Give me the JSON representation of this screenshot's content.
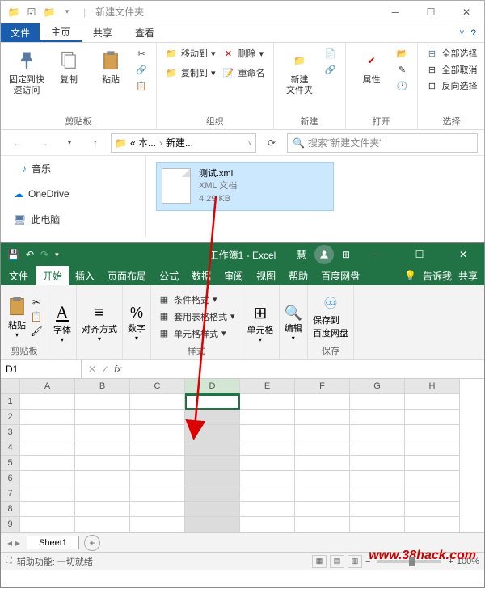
{
  "explorer": {
    "title": "新建文件夹",
    "tabs": {
      "file": "文件",
      "home": "主页",
      "share": "共享",
      "view": "查看"
    },
    "ribbon": {
      "clipboard": {
        "pin": "固定到快\n速访问",
        "copy": "复制",
        "paste": "粘贴",
        "label": "剪贴板"
      },
      "organize": {
        "moveto": "移动到",
        "delete": "删除",
        "copyto": "复制到",
        "rename": "重命名",
        "label": "组织"
      },
      "new": {
        "folder": "新建\n文件夹",
        "label": "新建"
      },
      "open": {
        "props": "属性",
        "label": "打开"
      },
      "select": {
        "all": "全部选择",
        "none": "全部取消",
        "invert": "反向选择",
        "label": "选择"
      }
    },
    "address": {
      "part1": "« 本...",
      "part2": "新建...",
      "search_placeholder": "搜索\"新建文件夹\""
    },
    "nav": {
      "music": "音乐",
      "onedrive": "OneDrive",
      "thispc": "此电脑"
    },
    "file": {
      "name": "测试.xml",
      "type": "XML 文档",
      "size": "4.29 KB"
    }
  },
  "excel": {
    "title": "工作簿1 - Excel",
    "user": "慧",
    "tabs": {
      "file": "文件",
      "home": "开始",
      "insert": "插入",
      "layout": "页面布局",
      "formulas": "公式",
      "data": "数据",
      "review": "审阅",
      "view": "视图",
      "help": "帮助",
      "baidu": "百度网盘",
      "tellme": "告诉我",
      "share": "共享"
    },
    "ribbon": {
      "paste": "粘贴",
      "clipboard": "剪贴板",
      "font": "字体",
      "align": "对齐方式",
      "number": "数字",
      "condformat": "条件格式",
      "tableformat": "套用表格格式",
      "cellstyle": "单元格样式",
      "styles": "样式",
      "cells": "单元格",
      "editing": "编辑",
      "saveto": "保存到\n百度网盘",
      "save": "保存"
    },
    "namebox": "D1",
    "columns": [
      "A",
      "B",
      "C",
      "D",
      "E",
      "F",
      "G",
      "H"
    ],
    "rows": [
      "1",
      "2",
      "3",
      "4",
      "5",
      "6",
      "7",
      "8",
      "9"
    ],
    "sheet": "Sheet1",
    "status": "辅助功能: 一切就绪",
    "zoom": "100%"
  },
  "watermark": "www.38hack.com"
}
